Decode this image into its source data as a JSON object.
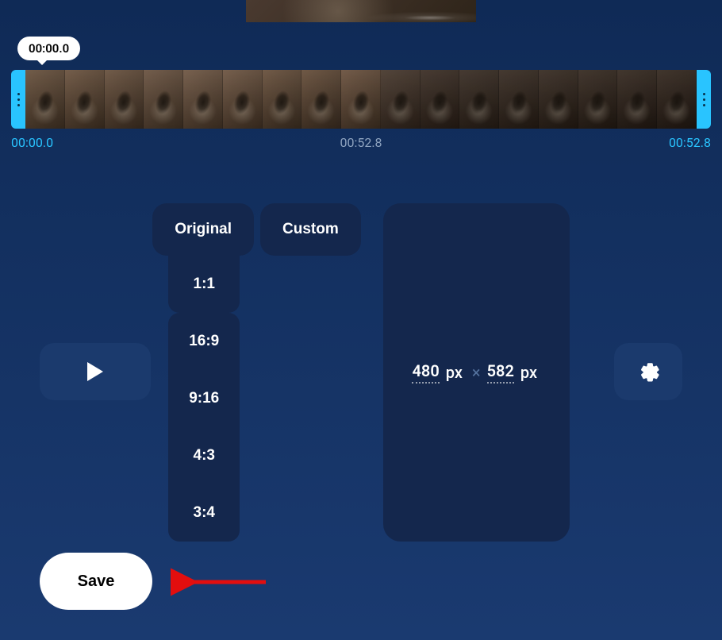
{
  "timeline": {
    "playhead_label": "00:00.0",
    "time_start": "00:00.0",
    "time_mid": "00:52.8",
    "time_end": "00:52.8"
  },
  "tabs": {
    "original": "Original",
    "custom": "Custom"
  },
  "ratios": {
    "r1": "1:1",
    "r2": "16:9",
    "r3": "9:16",
    "r4": "4:3",
    "r5": "3:4"
  },
  "dimensions": {
    "width": "480",
    "height": "582",
    "unit": "px",
    "separator": "×"
  },
  "buttons": {
    "save": "Save"
  },
  "icons": {
    "play": "play-icon",
    "settings": "gear-icon",
    "trim_handle": "drag-handle-icon"
  }
}
